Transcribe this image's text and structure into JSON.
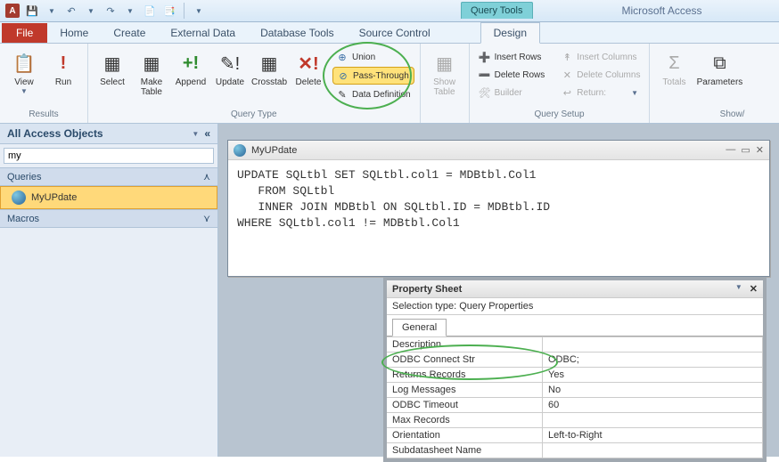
{
  "app_title": "Microsoft Access",
  "context_tab": "Query Tools",
  "qat_icon_letter": "A",
  "ribbon_tabs": {
    "file": "File",
    "items": [
      "Home",
      "Create",
      "External Data",
      "Database Tools",
      "Source Control",
      "Design"
    ],
    "active": "Design"
  },
  "ribbon": {
    "results": {
      "label": "Results",
      "view": "View",
      "run": "Run"
    },
    "query_type": {
      "label": "Query Type",
      "select": "Select",
      "make_table": "Make\nTable",
      "append": "Append",
      "update": "Update",
      "crosstab": "Crosstab",
      "delete": "Delete",
      "union": "Union",
      "pass_through": "Pass-Through",
      "data_definition": "Data Definition"
    },
    "show_table": "Show\nTable",
    "query_setup": {
      "label": "Query Setup",
      "insert_rows": "Insert Rows",
      "delete_rows": "Delete Rows",
      "builder": "Builder",
      "insert_columns": "Insert Columns",
      "delete_columns": "Delete Columns",
      "return": "Return:"
    },
    "showhide": {
      "label": "Show/",
      "totals": "Totals",
      "parameters": "Parameters"
    }
  },
  "nav": {
    "header": "All Access Objects",
    "search_value": "my",
    "queries_label": "Queries",
    "macros_label": "Macros",
    "item": "MyUPdate"
  },
  "sql_window": {
    "title": "MyUPdate",
    "sql": "UPDATE SQLtbl SET SQLtbl.col1 = MDBtbl.Col1\n   FROM SQLtbl\n   INNER JOIN MDBtbl ON SQLtbl.ID = MDBtbl.ID\nWHERE SQLtbl.col1 != MDBtbl.Col1"
  },
  "propsheet": {
    "title": "Property Sheet",
    "selection": "Selection type:  Query Properties",
    "tab": "General",
    "rows": [
      {
        "k": "Description",
        "v": ""
      },
      {
        "k": "ODBC Connect Str",
        "v": "ODBC;"
      },
      {
        "k": "Returns Records",
        "v": "Yes"
      },
      {
        "k": "Log Messages",
        "v": "No"
      },
      {
        "k": "ODBC Timeout",
        "v": "60"
      },
      {
        "k": "Max Records",
        "v": ""
      },
      {
        "k": "Orientation",
        "v": "Left-to-Right"
      },
      {
        "k": "Subdatasheet Name",
        "v": ""
      }
    ]
  }
}
